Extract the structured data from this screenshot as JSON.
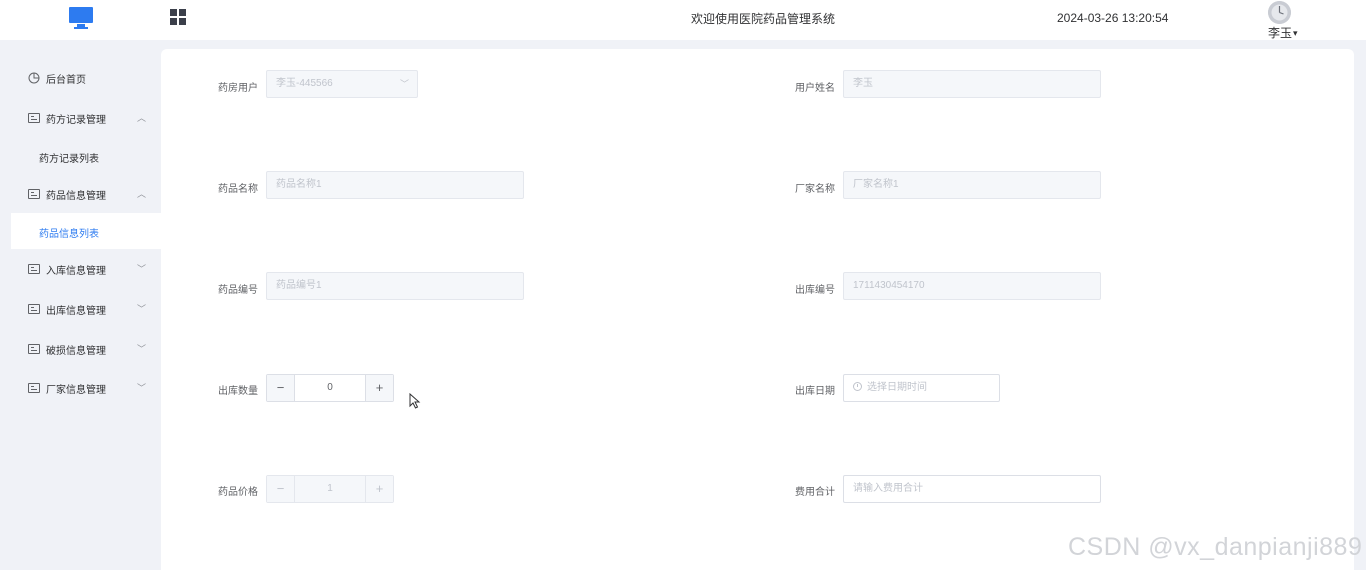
{
  "header": {
    "title": "欢迎使用医院药品管理系统",
    "datetime": "2024-03-26 13:20:54",
    "user": "李玉"
  },
  "sidebar": {
    "items": [
      {
        "label": "后台首页"
      },
      {
        "label": "药方记录管理",
        "children": [
          {
            "label": "药方记录列表"
          }
        ]
      },
      {
        "label": "药品信息管理",
        "children": [
          {
            "label": "药品信息列表",
            "active": true
          }
        ]
      },
      {
        "label": "入库信息管理"
      },
      {
        "label": "出库信息管理"
      },
      {
        "label": "破损信息管理"
      },
      {
        "label": "厂家信息管理"
      }
    ]
  },
  "form": {
    "pharmacy_user": {
      "label": "药房用户",
      "value": "李玉-445566"
    },
    "user_name": {
      "label": "用户姓名",
      "value": "李玉"
    },
    "drug_name": {
      "label": "药品名称",
      "value": "药品名称1"
    },
    "vendor_name": {
      "label": "厂家名称",
      "value": "厂家名称1"
    },
    "drug_code": {
      "label": "药品编号",
      "value": "药品编号1"
    },
    "outbound_code": {
      "label": "出库编号",
      "value": "1711430454170"
    },
    "outbound_qty": {
      "label": "出库数量",
      "value": "0"
    },
    "outbound_date": {
      "label": "出库日期",
      "placeholder": "选择日期时间"
    },
    "drug_price": {
      "label": "药品价格",
      "value": "1"
    },
    "total_cost": {
      "label": "费用合计",
      "placeholder": "请输入费用合计"
    }
  },
  "watermark": "CSDN @vx_danpianji889",
  "colors": {
    "accent": "#2d7bf0",
    "sidebar_bg": "#f0f2f7",
    "card_bg": "#ffffff"
  }
}
